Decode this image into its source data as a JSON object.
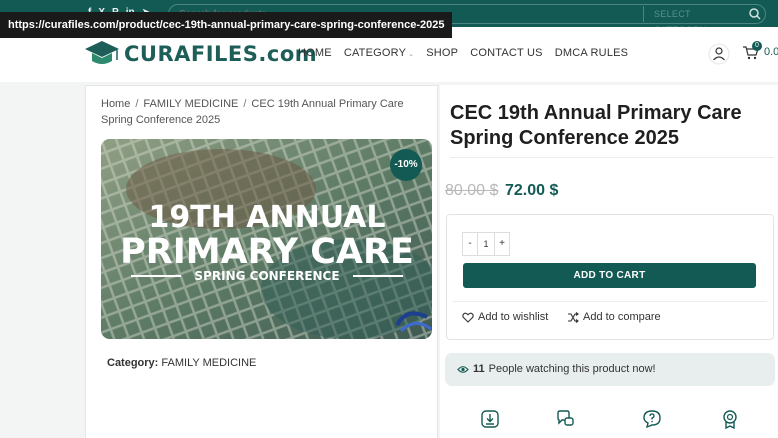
{
  "topbar": {
    "social_icons": [
      "facebook-icon",
      "x-icon",
      "pinterest-icon",
      "linkedin-icon",
      "telegram-icon"
    ],
    "search_placeholder": "Search for products",
    "select_category": "SELECT CATEGORY"
  },
  "url_tooltip": "https://curafiles.com/product/cec-19th-annual-primary-care-spring-conference-2025",
  "header": {
    "logo_text": "CURAFILES.com",
    "nav": [
      "HOME",
      "CATEGORY",
      "SHOP",
      "CONTACT US",
      "DMCA RULES"
    ],
    "cart_count": "0",
    "cart_total": "0.0"
  },
  "breadcrumb": {
    "home": "Home",
    "category": "FAMILY MEDICINE",
    "current": "CEC 19th Annual Primary Care Spring Conference 2025"
  },
  "product": {
    "title": "CEC 19th Annual Primary Care Spring Conference 2025",
    "sale_badge": "-10%",
    "image_text": [
      "19TH ANNUAL",
      "PRIMARY CARE",
      "SPRING CONFERENCE"
    ],
    "price_old": "80.00 $",
    "price_new": "72.00 $",
    "quantity": "1",
    "qty_minus": "-",
    "qty_plus": "+",
    "add_to_cart": "ADD TO CART",
    "wishlist": "Add to wishlist",
    "compare": "Add to compare",
    "category_label": "Category:",
    "category_value": "FAMILY MEDICINE",
    "watching_count": "11",
    "watching_text": "People watching this product now!"
  },
  "colors": {
    "brand": "#135a54",
    "panel_bg": "#e7eeed"
  },
  "feature_icons": [
    "download-icon",
    "chat-bubbles-icon",
    "question-bubble-icon",
    "badge-icon"
  ]
}
